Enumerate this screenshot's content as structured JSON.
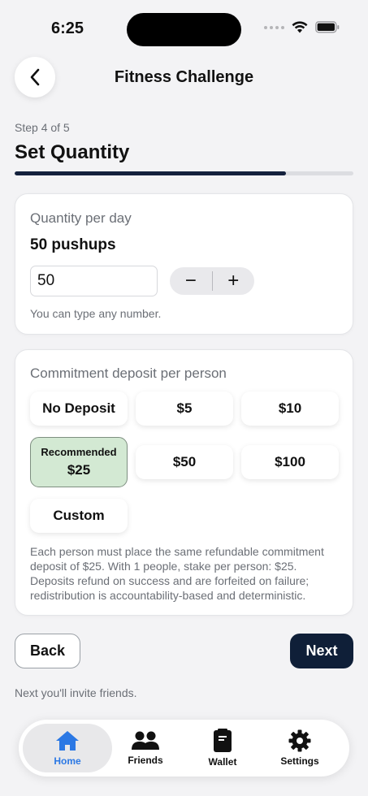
{
  "status_bar": {
    "time": "6:25"
  },
  "nav": {
    "title": "Fitness Challenge",
    "back_icon": "chevron-left-icon"
  },
  "step": {
    "text": "Step 4 of 5",
    "progress_fraction": 0.8
  },
  "page_title": "Set Quantity",
  "quantity_card": {
    "label": "Quantity per day",
    "summary": "50 pushups",
    "input_value": "50",
    "decrement_label": "−",
    "increment_label": "+",
    "hint": "You can type any number."
  },
  "deposit_card": {
    "label": "Commitment deposit per person",
    "options": {
      "no_deposit": "No Deposit",
      "five": "$5",
      "ten": "$10",
      "recommended_tag": "Recommended",
      "twenty_five": "$25",
      "fifty": "$50",
      "hundred": "$100",
      "custom": "Custom"
    },
    "selected": "$25",
    "description": "Each person must place the same refundable commitment deposit of $25. With 1 people, stake per person: $25. Deposits refund on success and are forfeited on failure; redistribution is accountability-based and deterministic."
  },
  "actions": {
    "back_label": "Back",
    "next_label": "Next"
  },
  "footer_note": "Next you'll invite friends.",
  "tabbar": {
    "tabs": [
      {
        "label": "Home",
        "icon": "home-icon",
        "active": true
      },
      {
        "label": "Friends",
        "icon": "friends-icon",
        "active": false
      },
      {
        "label": "Wallet",
        "icon": "wallet-icon",
        "active": false
      },
      {
        "label": "Settings",
        "icon": "gear-icon",
        "active": false
      }
    ]
  },
  "colors": {
    "accent_dark": "#0f1f38",
    "progress": "#14213d",
    "selected_chip": "#d3e9d3",
    "active_tab": "#2b78e4"
  }
}
